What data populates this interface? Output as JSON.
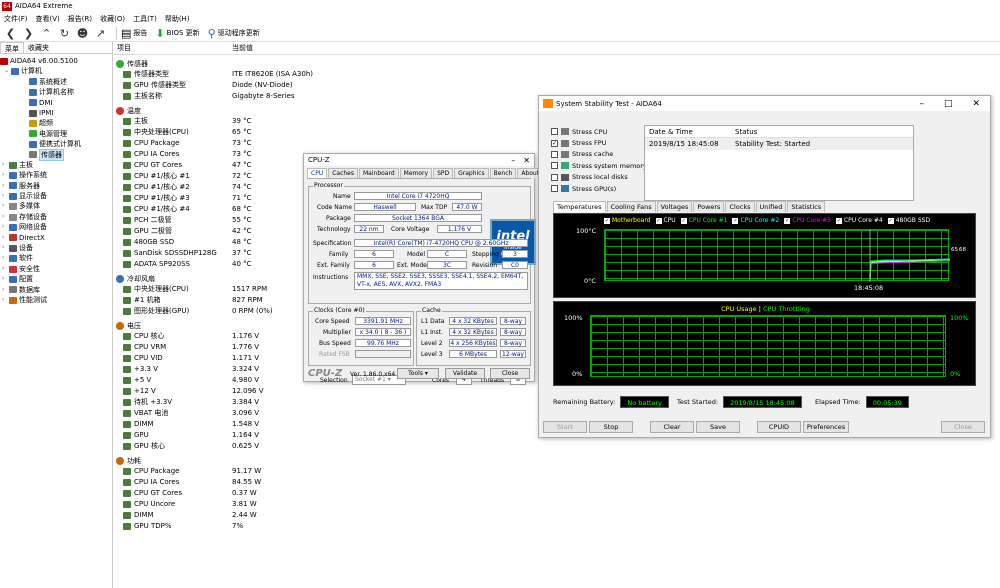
{
  "app": {
    "title": "AIDA64 Extreme",
    "icon": "64"
  },
  "menu": [
    "文件(F)",
    "查看(V)",
    "报告(R)",
    "收藏(O)",
    "工具(T)",
    "帮助(H)"
  ],
  "toolbar": {
    "report": "报告",
    "bios": "BIOS 更新",
    "driver": "驱动程序更新"
  },
  "leftpane": {
    "tab_menu": "菜单",
    "tab_fav": "收藏夹",
    "version": "AIDA64 v6.00.5100",
    "tree": [
      {
        "label": "计算机",
        "level": 1,
        "color": "#3a6fb5"
      },
      {
        "label": "系统概述",
        "level": 2,
        "color": "#3a6fb5"
      },
      {
        "label": "计算机名称",
        "level": 2,
        "color": "#3a6fb5"
      },
      {
        "label": "DMI",
        "level": 2,
        "color": "#3a6fb5"
      },
      {
        "label": "IPMI",
        "level": 2,
        "color": "#555"
      },
      {
        "label": "超频",
        "level": 2,
        "color": "#c90"
      },
      {
        "label": "电源管理",
        "level": 2,
        "color": "#3a3"
      },
      {
        "label": "便携式计算机",
        "level": 2,
        "color": "#3a6fb5"
      },
      {
        "label": "传感器",
        "level": 2,
        "color": "#777",
        "selected": true
      },
      {
        "label": "主板",
        "level": 0,
        "color": "#4a7d3a"
      },
      {
        "label": "操作系统",
        "level": 0,
        "color": "#3a6fb5"
      },
      {
        "label": "服务器",
        "level": 0,
        "color": "#3a6fb5"
      },
      {
        "label": "显示设备",
        "level": 0,
        "color": "#3a6fb5"
      },
      {
        "label": "多媒体",
        "level": 0,
        "color": "#888"
      },
      {
        "label": "存储设备",
        "level": 0,
        "color": "#888"
      },
      {
        "label": "网络设备",
        "level": 0,
        "color": "#3a6fb5"
      },
      {
        "label": "DirectX",
        "level": 0,
        "color": "#b33"
      },
      {
        "label": "设备",
        "level": 0,
        "color": "#555"
      },
      {
        "label": "软件",
        "level": 0,
        "color": "#3a6fb5"
      },
      {
        "label": "安全性",
        "level": 0,
        "color": "#c33"
      },
      {
        "label": "配置",
        "level": 0,
        "color": "#3a6fb5"
      },
      {
        "label": "数据库",
        "level": 0,
        "color": "#777"
      },
      {
        "label": "性能测试",
        "level": 0,
        "color": "#c60"
      }
    ]
  },
  "main": {
    "col_item": "项目",
    "col_value": "当前值",
    "sections": [
      {
        "title": "传感器",
        "icon": "#3a3",
        "rows": [
          [
            "传感器类型",
            "ITE IT8620E  (ISA A30h)"
          ],
          [
            "GPU 传感器类型",
            "Diode  (NV-Diode)"
          ],
          [
            "主板名称",
            "Gigabyte 8-Series"
          ]
        ]
      },
      {
        "title": "温度",
        "icon": "#c33",
        "rows": [
          [
            "主板",
            "39 °C"
          ],
          [
            "中央处理器(CPU)",
            "65 °C"
          ],
          [
            "CPU Package",
            "73 °C"
          ],
          [
            "CPU IA Cores",
            "73 °C"
          ],
          [
            "CPU GT Cores",
            "47 °C"
          ],
          [
            "CPU #1/核心 #1",
            "72 °C"
          ],
          [
            "CPU #1/核心 #2",
            "74 °C"
          ],
          [
            "CPU #1/核心 #3",
            "71 °C"
          ],
          [
            "CPU #1/核心 #4",
            "68 °C"
          ],
          [
            "PCH 二极管",
            "55 °C"
          ],
          [
            "GPU 二极管",
            "42 °C"
          ],
          [
            "480GB SSD",
            "48 °C"
          ],
          [
            "SanDisk SDSSDHP128G",
            "37 °C"
          ],
          [
            "ADATA SP920SS",
            "40 °C"
          ]
        ]
      },
      {
        "title": "冷却风扇",
        "icon": "#3a6fb5",
        "rows": [
          [
            "中央处理器(CPU)",
            "1517 RPM"
          ],
          [
            "#1 机箱",
            "827 RPM"
          ],
          [
            "图形处理器(GPU)",
            "0 RPM  (0%)"
          ]
        ]
      },
      {
        "title": "电压",
        "icon": "#c60",
        "rows": [
          [
            "CPU 核心",
            "1.176 V"
          ],
          [
            "CPU VRM",
            "1.776 V"
          ],
          [
            "CPU VID",
            "1.171 V"
          ],
          [
            "+3.3 V",
            "3.324 V"
          ],
          [
            "+5 V",
            "4.980 V"
          ],
          [
            "+12 V",
            "12.096 V"
          ],
          [
            "待机 +3.3V",
            "3.384 V"
          ],
          [
            "VBAT 电池",
            "3.096 V"
          ],
          [
            "DIMM",
            "1.548 V"
          ],
          [
            "GPU",
            "1.164 V"
          ],
          [
            "GPU 核心",
            "0.625 V"
          ]
        ]
      },
      {
        "title": "功耗",
        "icon": "#c60",
        "rows": [
          [
            "CPU Package",
            "91.17 W"
          ],
          [
            "CPU IA Cores",
            "84.55 W"
          ],
          [
            "CPU GT Cores",
            "0.37 W"
          ],
          [
            "CPU Uncore",
            "3.81 W"
          ],
          [
            "DIMM",
            "2.44 W"
          ],
          [
            "GPU TDP%",
            "7%"
          ]
        ]
      }
    ]
  },
  "cpuz": {
    "title": "CPU-Z",
    "tabs": [
      "CPU",
      "Caches",
      "Mainboard",
      "Memory",
      "SPD",
      "Graphics",
      "Bench",
      "About"
    ],
    "processor_label": "Processor",
    "name_label": "Name",
    "name": "Intel Core i7 4720HQ",
    "codename_label": "Code Name",
    "codename": "Haswell",
    "maxtdp_label": "Max TDP",
    "maxtdp": "47.0 W",
    "package_label": "Package",
    "package": "Socket 1364 BGA",
    "tech_label": "Technology",
    "tech": "22 nm",
    "cv_label": "Core Voltage",
    "cv": "1.176 V",
    "spec_label": "Specification",
    "spec": "Intel(R) Core(TM) i7-4720HQ CPU @ 2.60GHz",
    "family_label": "Family",
    "family": "6",
    "model_label": "Model",
    "model": "C",
    "stepping_label": "Stepping",
    "stepping": "3",
    "extfam_label": "Ext. Family",
    "extfam": "6",
    "extmodel_label": "Ext. Model",
    "extmodel": "3C",
    "rev_label": "Revision",
    "rev": "C0",
    "instr_label": "Instructions",
    "instr": "MMX, SSE, SSE2, SSE3, SSSE3, SSE4.1, SSE4.2, EM64T, VT-x, AES, AVX, AVX2, FMA3",
    "clocks_label": "Clocks (Core #0)",
    "cs_label": "Core Speed",
    "cs": "3391.91 MHz",
    "mult_label": "Multiplier",
    "mult": "x 34.0 ( 8 - 36 )",
    "bus_label": "Bus Speed",
    "bus": "99.76 MHz",
    "fsb_label": "Rated FSB",
    "cache_label": "Cache",
    "l1d_label": "L1 Data",
    "l1d": "4 x 32 KBytes",
    "l1d_w": "8-way",
    "l1i_label": "L1 Inst.",
    "l1i": "4 x 32 KBytes",
    "l1i_w": "8-way",
    "l2_label": "Level 2",
    "l2": "4 x 256 KBytes",
    "l2_w": "8-way",
    "l3_label": "Level 3",
    "l3": "6 MBytes",
    "l3_w": "12-way",
    "sel_label": "Selection",
    "sel": "Socket #1",
    "cores_label": "Cores",
    "cores": "4",
    "threads_label": "Threads",
    "threads": "8",
    "brand": "CPU-Z",
    "version": "Ver. 1.86.0.x64",
    "tools": "Tools",
    "validate": "Validate",
    "close": "Close",
    "intel_word": "intel",
    "intel_inside": "inside",
    "intel_core": "CORE i7"
  },
  "sst": {
    "title": "System Stability Test - AIDA64",
    "checks": [
      {
        "label": "Stress CPU",
        "checked": false,
        "icon": "#777"
      },
      {
        "label": "Stress FPU",
        "checked": true,
        "icon": "#777"
      },
      {
        "label": "Stress cache",
        "checked": false,
        "icon": "#777"
      },
      {
        "label": "Stress system memory",
        "checked": false,
        "icon": "#3a7"
      },
      {
        "label": "Stress local disks",
        "checked": false,
        "icon": "#555"
      },
      {
        "label": "Stress GPU(s)",
        "checked": false,
        "icon": "#37a"
      }
    ],
    "table_head_dt": "Date & Time",
    "table_head_status": "Status",
    "row_dt": "2019/8/15 18:45:08",
    "row_status": "Stability Test: Started",
    "tabs": [
      "Temperatures",
      "Cooling Fans",
      "Voltages",
      "Powers",
      "Clocks",
      "Unified",
      "Statistics"
    ],
    "legend": [
      {
        "label": "Motherboard",
        "color": "#ff0"
      },
      {
        "label": "CPU",
        "color": "#fff"
      },
      {
        "label": "CPU Core #1",
        "color": "#0f0"
      },
      {
        "label": "CPU Core #2",
        "color": "#0ff"
      },
      {
        "label": "CPU Core #3",
        "color": "#f0f"
      },
      {
        "label": "CPU Core #4",
        "color": "#fff"
      },
      {
        "label": "480GB SSD",
        "color": "#fff"
      }
    ],
    "t_top": "100°C",
    "t_bot": "0°C",
    "t_time": "18:45:08",
    "t_val_a": "65",
    "t_val_b": "68",
    "u_title_a": "CPU Usage",
    "u_sep": "|",
    "u_title_b": "CPU Throttling",
    "u_top_l": "100%",
    "u_bot_l": "0%",
    "u_top_r": "100%",
    "u_bot_r": "0%",
    "battery_label": "Remaining Battery:",
    "battery": "No battery",
    "started_label": "Test Started:",
    "started": "2019/8/15 18:45:08",
    "elapsed_label": "Elapsed Time:",
    "elapsed": "00:05:39",
    "buttons": {
      "start": "Start",
      "stop": "Stop",
      "clear": "Clear",
      "save": "Save",
      "cpuid": "CPUID",
      "prefs": "Preferences",
      "close": "Close"
    }
  }
}
